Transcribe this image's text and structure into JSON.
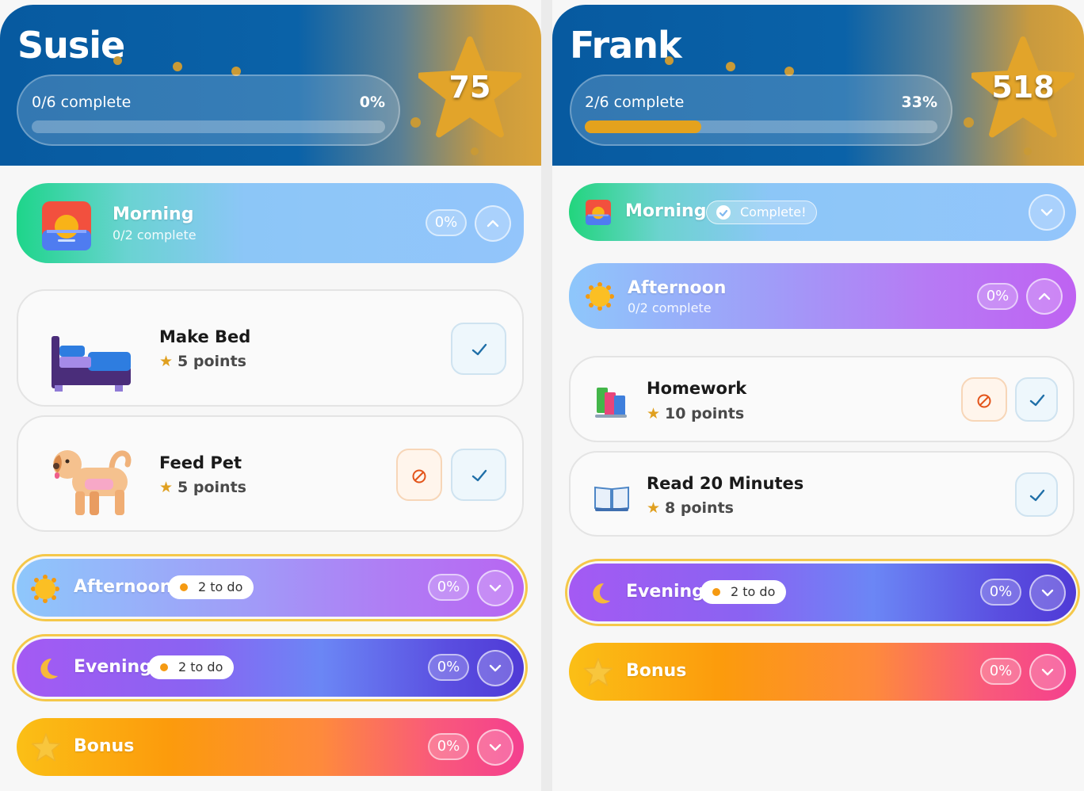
{
  "left": {
    "name": "Susie",
    "progress_label": "0/6 complete",
    "progress_pct": "0%",
    "progress_fraction": 0,
    "points": "75",
    "sections": {
      "morning": {
        "title": "Morning",
        "sub": "0/2 complete",
        "pct": "0%"
      },
      "afternoon": {
        "title": "Afternoon",
        "todo": "2 to do",
        "pct": "0%"
      },
      "evening": {
        "title": "Evening",
        "todo": "2 to do",
        "pct": "0%"
      },
      "bonus": {
        "title": "Bonus",
        "pct": "0%"
      }
    },
    "tasks": [
      {
        "name": "Make Bed",
        "points": "5 points",
        "icon": "bed-icon"
      },
      {
        "name": "Feed Pet",
        "points": "5 points",
        "icon": "dog-icon"
      }
    ]
  },
  "right": {
    "name": "Frank",
    "progress_label": "2/6 complete",
    "progress_pct": "33%",
    "progress_fraction": 0.33,
    "points": "518",
    "sections": {
      "morning": {
        "title": "Morning",
        "status": "Complete!"
      },
      "afternoon": {
        "title": "Afternoon",
        "sub": "0/2 complete",
        "pct": "0%"
      },
      "evening": {
        "title": "Evening",
        "todo": "2 to do",
        "pct": "0%"
      },
      "bonus": {
        "title": "Bonus",
        "pct": "0%"
      }
    },
    "tasks": [
      {
        "name": "Homework",
        "points": "10 points",
        "icon": "books-icon"
      },
      {
        "name": "Read 20 Minutes",
        "points": "8 points",
        "icon": "open-book-icon"
      }
    ]
  },
  "colors": {
    "accent_gold": "#e4a21d",
    "header_blue": "#075aa0",
    "check_blue": "#1f6fa8",
    "skip_orange": "#e3541a"
  }
}
